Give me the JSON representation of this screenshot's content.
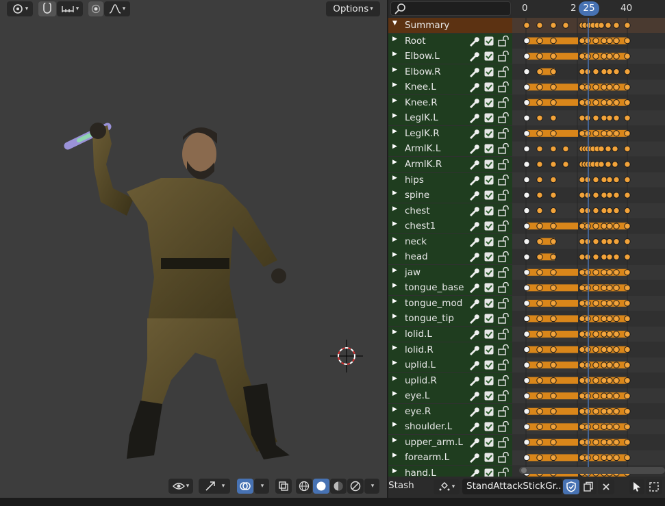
{
  "viewport": {
    "options_label": "Options",
    "header_icons": [
      "pivot-icon",
      "snap-magnet-icon",
      "snap-increment-icon",
      "proportional-edit-icon",
      "falloff-curve-icon"
    ],
    "footer_icons": [
      "visibility-eye-icon",
      "gizmo-icon",
      "overlay-icon",
      "xray-icon",
      "wireframe-shading-icon",
      "solid-shading-icon",
      "material-shading-icon",
      "rendered-shading-icon"
    ]
  },
  "dopesheet": {
    "timeline": {
      "labels": [
        "0",
        "2",
        "40"
      ],
      "current_frame": "25"
    },
    "channels": [
      {
        "name": "Summary",
        "kind": "summary"
      },
      {
        "name": "Root"
      },
      {
        "name": "Elbow.L"
      },
      {
        "name": "Elbow.R"
      },
      {
        "name": "Knee.L"
      },
      {
        "name": "Knee.R"
      },
      {
        "name": "LegIK.L"
      },
      {
        "name": "LegIK.R"
      },
      {
        "name": "ArmIK.L"
      },
      {
        "name": "ArmIK.R"
      },
      {
        "name": "hips"
      },
      {
        "name": "spine"
      },
      {
        "name": "chest"
      },
      {
        "name": "chest1"
      },
      {
        "name": "neck"
      },
      {
        "name": "head"
      },
      {
        "name": "jaw"
      },
      {
        "name": "tongue_base"
      },
      {
        "name": "tongue_mod"
      },
      {
        "name": "tongue_tip"
      },
      {
        "name": "lolid.L"
      },
      {
        "name": "lolid.R"
      },
      {
        "name": "uplid.L"
      },
      {
        "name": "uplid.R"
      },
      {
        "name": "eye.L"
      },
      {
        "name": "eye.R"
      },
      {
        "name": "shoulder.L"
      },
      {
        "name": "upper_arm.L"
      },
      {
        "name": "forearm.L"
      },
      {
        "name": "hand.L"
      }
    ],
    "footer": {
      "stash_label": "Stash",
      "action_name": "StandAttackStickGr..."
    }
  },
  "colors": {
    "accent": "#4772b3",
    "keyframe": "#f2a33a",
    "hold_bar": "#d9861a",
    "bone_row": "#1f3d1f",
    "summary_row": "#5c3212"
  }
}
